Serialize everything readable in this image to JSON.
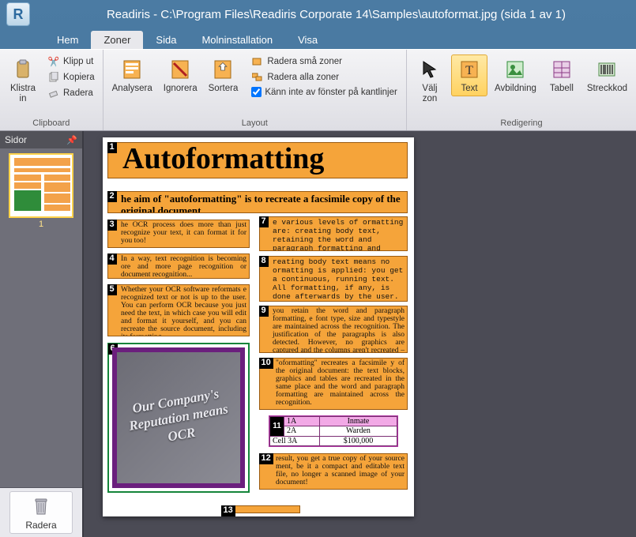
{
  "window": {
    "app_initial": "R",
    "title": "Readiris - C:\\Program Files\\Readiris Corporate 14\\Samples\\autoformat.jpg (sida 1 av 1)"
  },
  "tabs": {
    "hem": {
      "label": "Hem"
    },
    "zoner": {
      "label": "Zoner"
    },
    "sida": {
      "label": "Sida"
    },
    "moln": {
      "label": "Molninstallation"
    },
    "visa": {
      "label": "Visa"
    },
    "active": "zoner"
  },
  "ribbon": {
    "clipboard": {
      "group_label": "Clipboard",
      "klistra_in": "Klistra\nin",
      "klipp_ut": "Klipp ut",
      "kopiera": "Kopiera",
      "radera": "Radera"
    },
    "layout": {
      "group_label": "Layout",
      "analysera": "Analysera",
      "ignorera": "Ignorera",
      "sortera": "Sortera",
      "radera_sma": "Radera små zoner",
      "radera_alla": "Radera alla zoner",
      "kann_inte": "Känn inte av fönster på kantlinjer"
    },
    "redigering": {
      "group_label": "Redigering",
      "valj_zon": "Välj\nzon",
      "text": "Text",
      "avbildning": "Avbildning",
      "tabell": "Tabell",
      "streckkod": "Streckkod"
    }
  },
  "side": {
    "header": "Sidor",
    "thumb_caption": "1",
    "radera_btn": "Radera"
  },
  "doc": {
    "z1": "Autoformatting",
    "z2": "he aim of \"autoformatting\" is to recreate a facsimile copy of the original document.",
    "z3": "he OCR process does more than just recognize your text, it can format it for you too!",
    "z4": "In a way, text recognition is becoming ore and more page recognition or document recognition...",
    "z5": "Whether your OCR software reformats e recognized text or not is up to the user. You can perform OCR because you just need the text, in which case you will edit and format it yourself, and you can recreate the source document, including its formatting.",
    "z6": "Our Company's Reputation means OCR",
    "z7": "e various levels of ormatting are: creating body text, retaining the word and paragraph formatting and creating a facsimile copy.",
    "z8": "reating body text means no ormatting is applied: you get a continuous, running text. All formatting, if any, is done afterwards by the user.",
    "z9": "you retain the word and paragraph formatting, e font type, size and typestyle are maintained across the recognition. The justification of the paragraphs is also detected. However, no graphics are captured and the columns aren't recreated – the paragraph just follow each other etc.",
    "z10": "\"oformatting\" recreates a facsimile y of the original document: the text blocks, graphics and tables are recreated in the same place and the word and paragraph formatting are maintained across the recognition.",
    "z12": "result, you get a true copy of your source ment, be it a compact and editable text file, no longer a scanned image of your document!"
  },
  "chart_data": {
    "type": "table",
    "note": "Zone 11 table inside the scanned document",
    "rows": [
      {
        "id": "1A",
        "label": "Inmate"
      },
      {
        "id": "2A",
        "label": "Warden"
      },
      {
        "id_prefix": "Cell",
        "id": "3A",
        "label": "$100,000"
      }
    ]
  }
}
